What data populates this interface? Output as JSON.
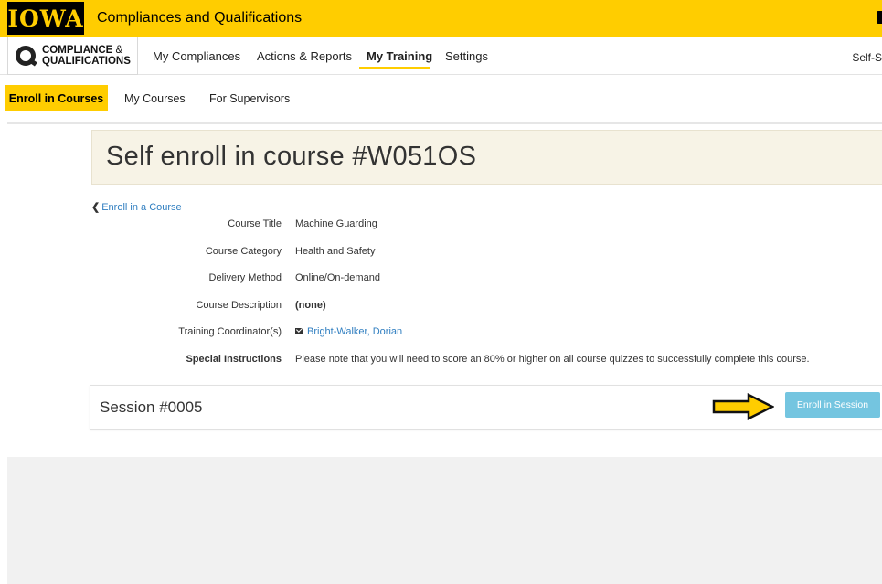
{
  "topbar": {
    "logo_text": "IOWA",
    "title": "Compliances and Qualifications",
    "brand_color": "#FFCD00"
  },
  "app_logo": {
    "line1_bold": "COMPLIANCE",
    "line1_amp": " &",
    "line2": "QUALIFICATIONS",
    "icon": "cq-logo-icon"
  },
  "nav": {
    "items": [
      {
        "label": "My Compliances"
      },
      {
        "label": "Actions & Reports"
      },
      {
        "label": "My Training",
        "active": true
      },
      {
        "label": "Settings"
      }
    ],
    "right_text": "Self-S"
  },
  "subnav": {
    "items": [
      {
        "label": "Enroll in Courses",
        "active": true
      },
      {
        "label": "My Courses"
      },
      {
        "label": "For Supervisors"
      }
    ]
  },
  "page": {
    "title": "Self enroll in course #W051OS",
    "back_link": "Enroll in a Course"
  },
  "details": [
    {
      "label": "Course Title",
      "value": "Machine Guarding"
    },
    {
      "label": "Course Category",
      "value": "Health and Safety"
    },
    {
      "label": "Delivery Method",
      "value": "Online/On-demand"
    },
    {
      "label": "Course Description",
      "value": "(none)"
    },
    {
      "label": "Training Coordinator(s)",
      "value": "Bright-Walker, Dorian"
    },
    {
      "label": "Special Instructions",
      "value": "Please note that you will need to score an 80% or higher on all course quizzes to successfully complete this course."
    }
  ],
  "session": {
    "title": "Session #0005",
    "enroll_button": "Enroll in Session",
    "arrow_icon": "right-arrow-annotation-icon",
    "button_color": "#74C5E0"
  }
}
